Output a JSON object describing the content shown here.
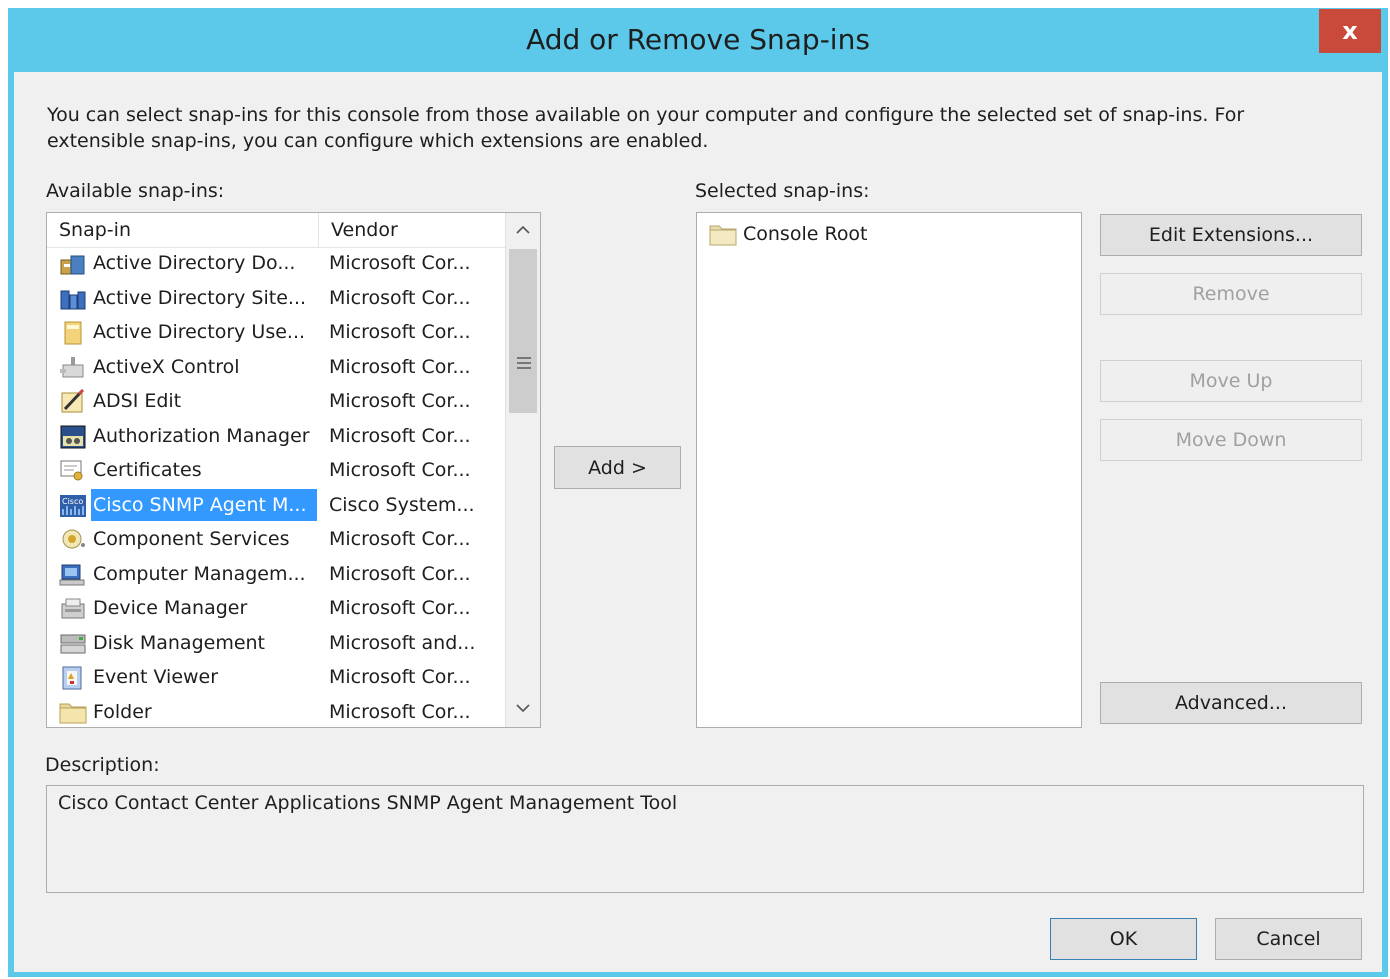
{
  "window": {
    "title": "Add or Remove Snap-ins",
    "close_label": "x"
  },
  "intro_text": "You can select snap-ins for this console from those available on your computer and configure the selected set of snap-ins. For extensible snap-ins, you can configure which extensions are enabled.",
  "available": {
    "label": "Available snap-ins:",
    "columns": {
      "snapin": "Snap-in",
      "vendor": "Vendor"
    },
    "rows": [
      {
        "name": "Active Directory Do...",
        "vendor": "Microsoft Cor...",
        "icon": "domains-trusts-icon"
      },
      {
        "name": "Active Directory Site...",
        "vendor": "Microsoft Cor...",
        "icon": "sites-services-icon"
      },
      {
        "name": "Active Directory Use...",
        "vendor": "Microsoft Cor...",
        "icon": "users-computers-icon"
      },
      {
        "name": "ActiveX Control",
        "vendor": "Microsoft Cor...",
        "icon": "activex-icon"
      },
      {
        "name": "ADSI Edit",
        "vendor": "Microsoft Cor...",
        "icon": "adsi-edit-icon"
      },
      {
        "name": "Authorization Manager",
        "vendor": "Microsoft Cor...",
        "icon": "authorization-icon"
      },
      {
        "name": "Certificates",
        "vendor": "Microsoft Cor...",
        "icon": "certificate-icon"
      },
      {
        "name": "Cisco SNMP Agent M...",
        "vendor": "Cisco System...",
        "icon": "cisco-icon",
        "selected": true
      },
      {
        "name": "Component Services",
        "vendor": "Microsoft Cor...",
        "icon": "component-services-icon"
      },
      {
        "name": "Computer Managem...",
        "vendor": "Microsoft Cor...",
        "icon": "computer-management-icon"
      },
      {
        "name": "Device Manager",
        "vendor": "Microsoft Cor...",
        "icon": "device-manager-icon"
      },
      {
        "name": "Disk Management",
        "vendor": "Microsoft and...",
        "icon": "disk-management-icon"
      },
      {
        "name": "Event Viewer",
        "vendor": "Microsoft Cor...",
        "icon": "event-viewer-icon"
      },
      {
        "name": "Folder",
        "vendor": "Microsoft Cor...",
        "icon": "folder-icon"
      }
    ]
  },
  "add_button": "Add >",
  "selected": {
    "label": "Selected snap-ins:",
    "items": [
      {
        "name": "Console Root",
        "icon": "folder-icon"
      }
    ]
  },
  "side_buttons": {
    "edit_extensions": "Edit Extensions...",
    "remove": "Remove",
    "move_up": "Move Up",
    "move_down": "Move Down",
    "advanced": "Advanced..."
  },
  "description": {
    "label": "Description:",
    "text": "Cisco Contact Center Applications SNMP Agent Management Tool"
  },
  "footer": {
    "ok": "OK",
    "cancel": "Cancel"
  },
  "colors": {
    "titlebar": "#5cc9ea",
    "close": "#c94a3b",
    "selection": "#3399ff"
  }
}
